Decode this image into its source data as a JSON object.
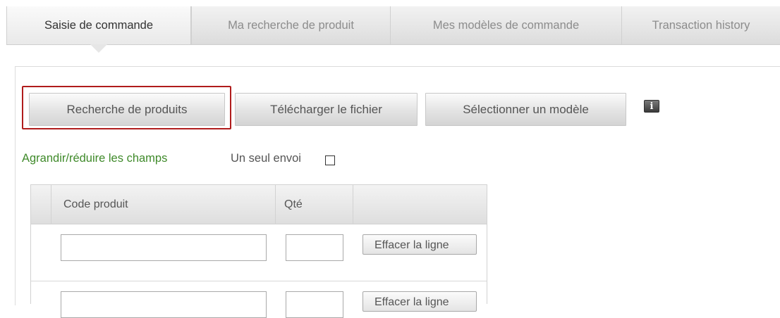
{
  "tabs": [
    {
      "label": "Saisie de commande",
      "active": true
    },
    {
      "label": "Ma recherche de produit",
      "active": false
    },
    {
      "label": "Mes modèles de commande",
      "active": false
    },
    {
      "label": "Transaction history",
      "active": false
    }
  ],
  "toolbar": {
    "search_products_label": "Recherche de produits",
    "upload_file_label": "Télécharger le fichier",
    "select_template_label": "Sélectionner un modèle",
    "info_icon": "i"
  },
  "options": {
    "toggle_fields_label": "Agrandir/réduire les champs",
    "single_shipment_label": "Un seul envoi",
    "single_shipment_checked": false
  },
  "order_grid": {
    "columns": {
      "product_code": "Code produit",
      "quantity": "Qté"
    },
    "rows": [
      {
        "product_code": "",
        "quantity": "",
        "clear_label": "Effacer la ligne"
      },
      {
        "product_code": "",
        "quantity": "",
        "clear_label": "Effacer la ligne"
      }
    ]
  },
  "colors": {
    "accent_link": "#3f8a2a",
    "highlight_border": "#b01c1c"
  }
}
